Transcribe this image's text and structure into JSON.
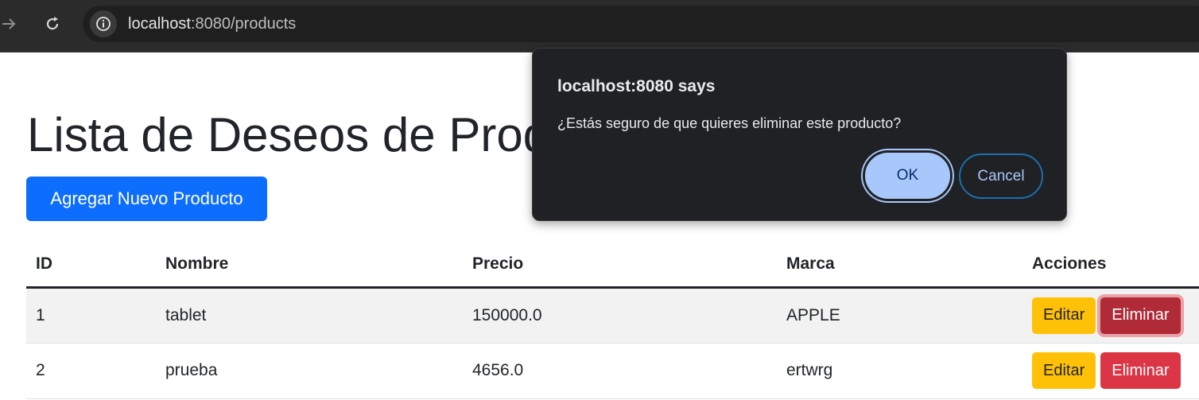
{
  "browser": {
    "url_host": "localhost",
    "url_path": ":8080/products",
    "forward_icon": "arrow-right-icon",
    "reload_icon": "reload-icon",
    "info_icon": "info-icon"
  },
  "page": {
    "title": "Lista de Deseos de Productos",
    "add_button_label": "Agregar Nuevo Producto"
  },
  "table": {
    "headers": [
      "ID",
      "Nombre",
      "Precio",
      "Marca",
      "Acciones"
    ],
    "rows": [
      {
        "id": "1",
        "name": "tablet",
        "price": "150000.0",
        "brand": "APPLE",
        "edit_label": "Editar",
        "delete_label": "Eliminar"
      },
      {
        "id": "2",
        "name": "prueba",
        "price": "4656.0",
        "brand": "ertwrg",
        "edit_label": "Editar",
        "delete_label": "Eliminar"
      }
    ]
  },
  "dialog": {
    "title": "localhost:8080 says",
    "message": "¿Estás seguro de que quieres eliminar este producto?",
    "ok_label": "OK",
    "cancel_label": "Cancel"
  },
  "colors": {
    "primary": "#0d6efd",
    "warning": "#ffc107",
    "danger": "#dc3545",
    "dialog_bg": "#202124",
    "dialog_accent": "#a8c7fa"
  }
}
